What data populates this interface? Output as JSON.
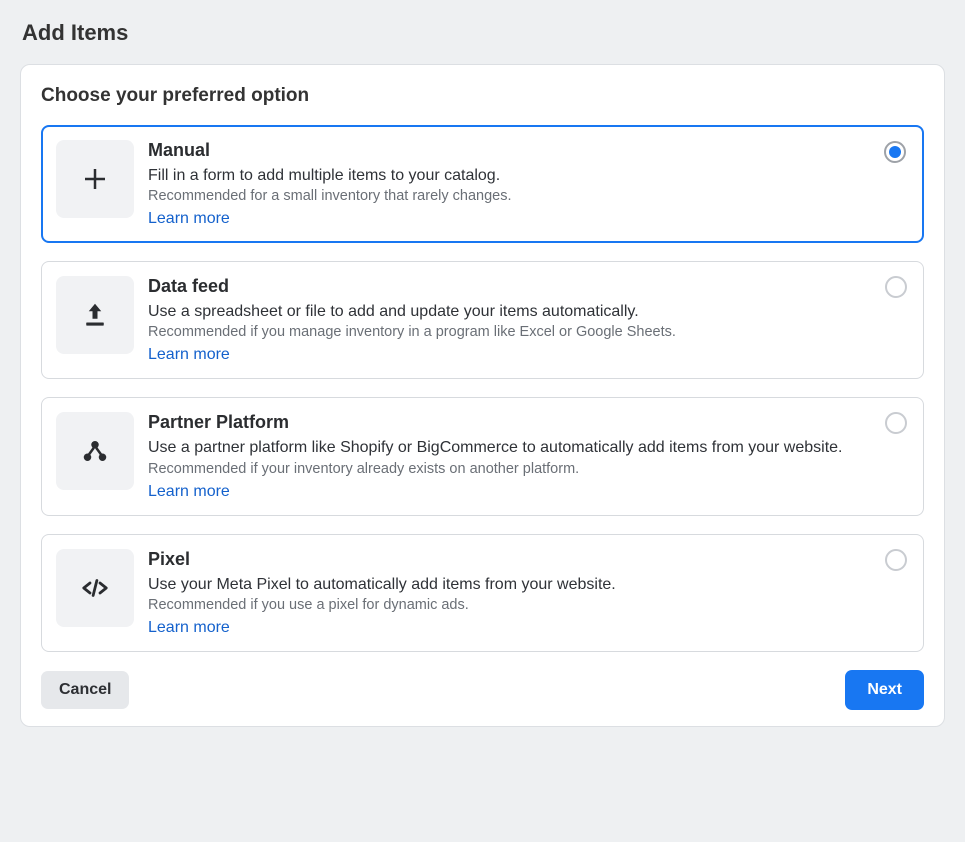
{
  "page_title": "Add Items",
  "section_title": "Choose your preferred option",
  "options": [
    {
      "id": "manual",
      "title": "Manual",
      "description": "Fill in a form to add multiple items to your catalog.",
      "recommendation": "Recommended for a small inventory that rarely changes.",
      "learn_more": "Learn more",
      "icon": "plus-icon",
      "selected": true
    },
    {
      "id": "data-feed",
      "title": "Data feed",
      "description": "Use a spreadsheet or file to add and update your items automatically.",
      "recommendation": "Recommended if you manage inventory in a program like Excel or Google Sheets.",
      "learn_more": "Learn more",
      "icon": "upload-icon",
      "selected": false
    },
    {
      "id": "partner-platform",
      "title": "Partner Platform",
      "description": "Use a partner platform like Shopify or BigCommerce to automatically add items from your website.",
      "recommendation": "Recommended if your inventory already exists on another platform.",
      "learn_more": "Learn more",
      "icon": "platform-icon",
      "selected": false
    },
    {
      "id": "pixel",
      "title": "Pixel",
      "description": "Use your Meta Pixel to automatically add items from your website.",
      "recommendation": "Recommended if you use a pixel for dynamic ads.",
      "learn_more": "Learn more",
      "icon": "code-icon",
      "selected": false
    }
  ],
  "buttons": {
    "cancel": "Cancel",
    "next": "Next"
  }
}
